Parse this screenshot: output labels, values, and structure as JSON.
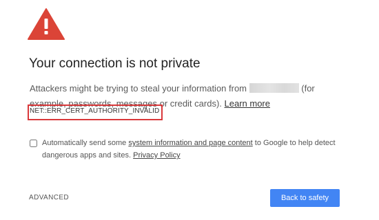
{
  "icons": {
    "warning": "warning-triangle-icon"
  },
  "colors": {
    "warning_red": "#db4437",
    "error_border": "#d9383a",
    "primary_button": "#4285f4"
  },
  "title": "Your connection is not private",
  "message": {
    "part1": "Attackers might be trying to steal your information from",
    "part2": "(for example, passwords, messages or credit cards).",
    "learn_more": "Learn more"
  },
  "error_code": "NET::ERR_CERT_AUTHORITY_INVALID",
  "report": {
    "checked": false,
    "part1": "Automatically send some",
    "system_info_link": "system information and page content",
    "part2": "to Google to help detect dangerous apps and sites.",
    "privacy_link": "Privacy Policy"
  },
  "advanced_label": "ADVANCED",
  "back_button_label": "Back to safety"
}
